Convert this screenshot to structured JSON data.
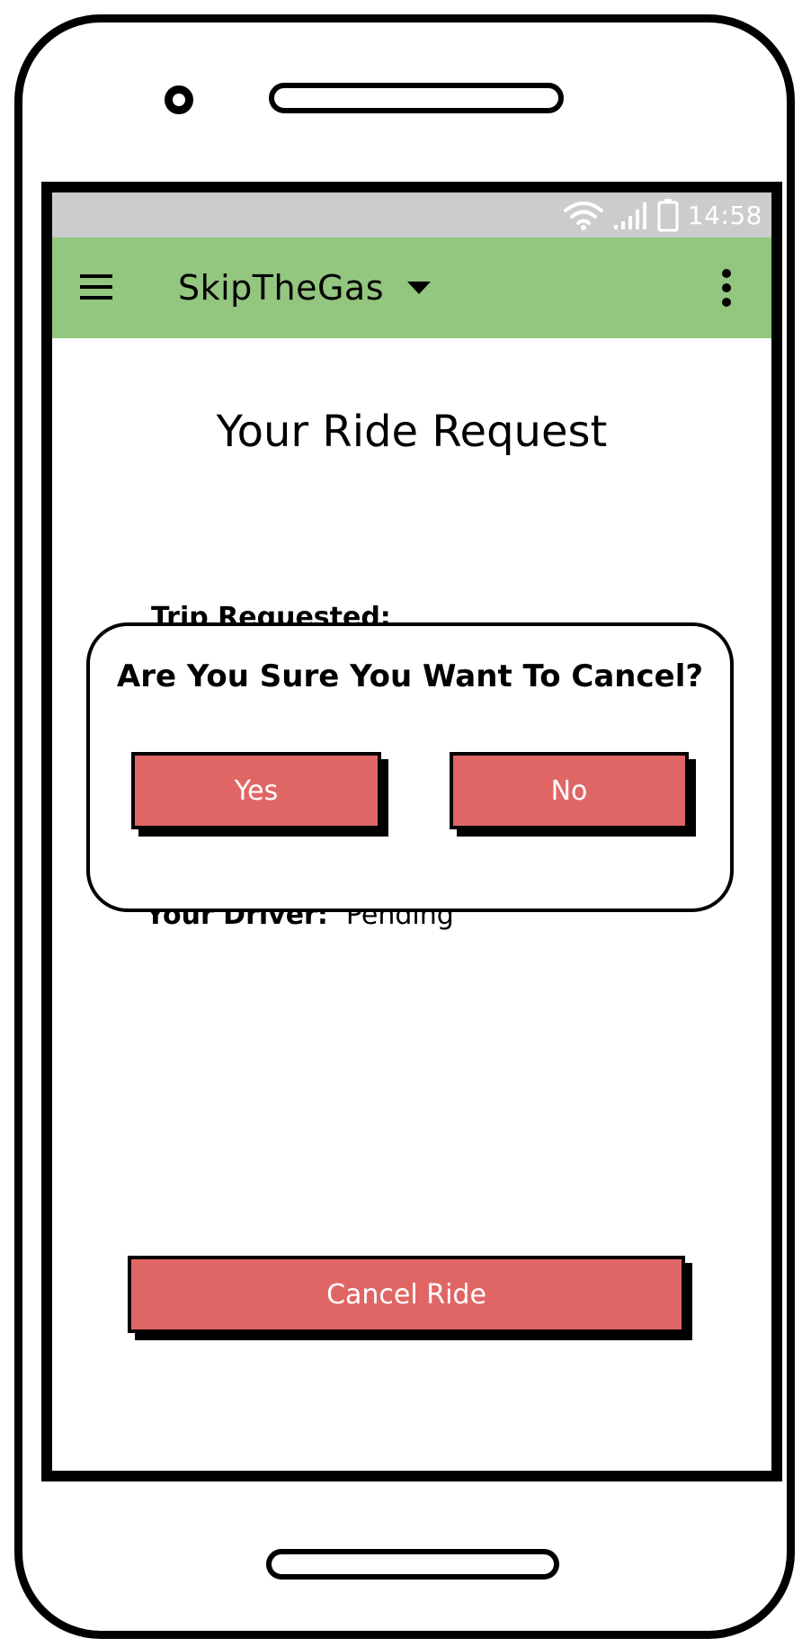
{
  "status_bar": {
    "time": "14:58",
    "icons": [
      "wifi-icon",
      "signal-icon",
      "battery-icon"
    ]
  },
  "app_bar": {
    "title": "SkipTheGas",
    "icons": [
      "menu-icon",
      "chevron-down-icon",
      "overflow-menu-icon"
    ],
    "color": "#93c67f"
  },
  "page": {
    "title": "Your Ride Request",
    "trip_requested_label": "Trip Requested:",
    "driver_label": "Your Driver:",
    "driver_value": "Pending",
    "cancel_button_label": "Cancel Ride"
  },
  "dialog": {
    "title": "Are You Sure You Want To Cancel?",
    "yes_label": "Yes",
    "no_label": "No"
  },
  "colors": {
    "status_bar": "#cccccc",
    "app_bar": "#93c67f",
    "button": "#e06666",
    "button_text": "#ffffff"
  }
}
